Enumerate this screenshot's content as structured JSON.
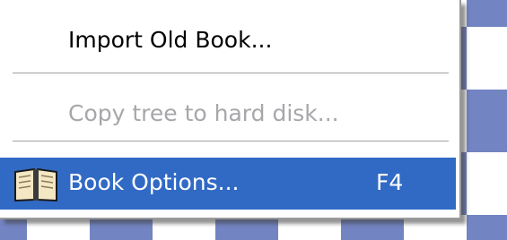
{
  "menu": {
    "items": [
      {
        "label": "Import Old Book...",
        "enabled": true
      },
      {
        "label": "Copy tree to hard disk...",
        "enabled": false
      },
      {
        "label": "Book Options...",
        "shortcut": "F4",
        "icon": "book-icon",
        "selected": true
      }
    ]
  },
  "colors": {
    "highlight": "#316ac5",
    "disabled_text": "#a7a6aa",
    "board_dark": "#7384c2",
    "board_light": "#ffffff"
  }
}
